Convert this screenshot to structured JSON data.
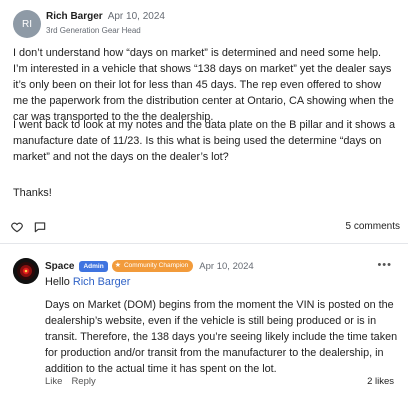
{
  "post": {
    "avatar_initials": "RI",
    "author_name": "Rich Barger",
    "date": "Apr 10, 2024",
    "role": "3rd Generation Gear Head",
    "paragraphs": [
      "I don’t understand how “days on market” is determined and need some help.  I’m interested in a vehicle that shows “138 days on market” yet the dealer says it’s only been on their lot for less than 45 days.  The rep even offered to show me the paperwork from the distribution center at Ontario, CA showing when the car was transported to the the dealership.",
      "I went back to look at my notes and the data plate on the B pillar and it shows a manufacture date of 11/23.  Is this what is being used the determine “days on market” and not the days on the dealer’s lot?",
      "Thanks!"
    ],
    "comments_label": "5 comments"
  },
  "reply": {
    "author_name": "Space",
    "admin_badge": "Admin",
    "champion_badge": "Community Champion",
    "date": "Apr 10, 2024",
    "more_label": "•••",
    "hello_prefix": "Hello ",
    "mention": "Rich Barger",
    "text": "Days on Market (DOM) begins from the moment the VIN is posted on the dealership’s website, even if the vehicle is still being produced or is in transit. Therefore, the 138 days you’re seeing likely include the time taken for production and/or transit from the manufacturer to the dealership, in addition to the actual time it has spent on the lot.",
    "like_label": "Like",
    "reply_label": "Reply",
    "likes_label": "2 likes"
  },
  "colors": {
    "admin_badge": "#3f74e0",
    "champion_badge": "#f29b3b",
    "mention": "#2f62c6",
    "avatar_bg": "#8e9aa6"
  }
}
